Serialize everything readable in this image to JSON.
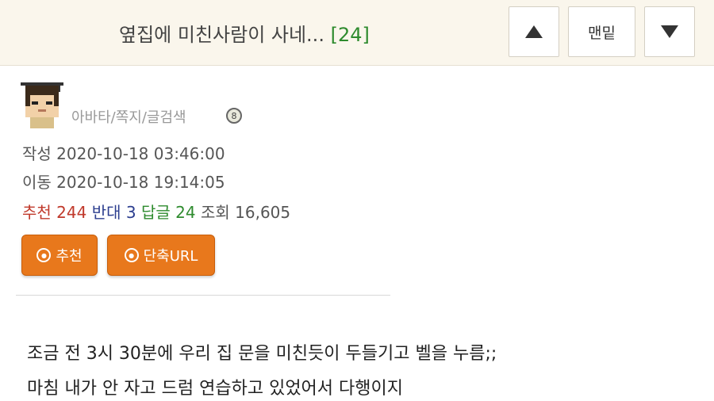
{
  "header": {
    "title": "옆집에 미친사람이 사네...",
    "reply_count": "[24]",
    "top_button": "▲",
    "bottom_button": "맨밑",
    "down_button": "▼"
  },
  "author": {
    "links": "아바타/쪽지/글검색",
    "level": "8"
  },
  "meta": {
    "written_label": "작성",
    "written_value": "2020-10-18 03:46:00",
    "moved_label": "이동",
    "moved_value": "2020-10-18 19:14:05"
  },
  "stats": {
    "recommend_label": "추천",
    "recommend_value": "244",
    "oppose_label": "반대",
    "oppose_value": "3",
    "reply_label": "답글",
    "reply_value": "24",
    "view_label": "조회",
    "view_value": "16,605"
  },
  "actions": {
    "recommend_label": "추천",
    "shorturl_label": "단축URL"
  },
  "content": {
    "line1": "조금 전 3시 30분에 우리 집 문을 미친듯이 두들기고 벨을 누름;;",
    "line2": "마침 내가 안 자고 드럼 연습하고 있었어서 다행이지"
  },
  "colors": {
    "header_bg": "#faf6ec",
    "accent_orange": "#e8781c",
    "recommend_red": "#c0392b",
    "oppose_blue": "#2c3e8f",
    "reply_green": "#2e8b2e"
  }
}
